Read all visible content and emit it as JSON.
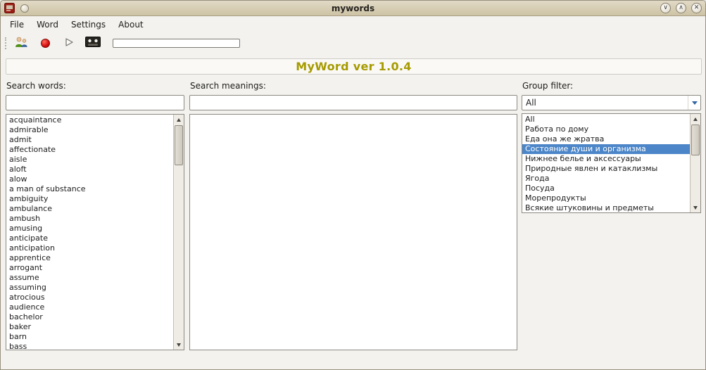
{
  "window": {
    "title": "mywords",
    "controls": [
      {
        "name": "minimize",
        "glyph": "∨"
      },
      {
        "name": "maximize",
        "glyph": "∧"
      },
      {
        "name": "close",
        "glyph": "✕"
      }
    ]
  },
  "menu": {
    "items": [
      "File",
      "Word",
      "Settings",
      "About"
    ]
  },
  "toolbar": {
    "buttons": [
      "users-icon",
      "record-icon",
      "play-icon",
      "cassette-icon"
    ],
    "progress_value": ""
  },
  "banner": {
    "title": "MyWord ver 1.0.4"
  },
  "words_panel": {
    "label": "Search words:",
    "input_value": "",
    "items": [
      "acquaintance",
      "admirable",
      "admit",
      "affectionate",
      "aisle",
      "aloft",
      "alow",
      "a man of substance",
      "ambiguity",
      "ambulance",
      "ambush",
      "amusing",
      "anticipate",
      "anticipation",
      "apprentice",
      "arrogant",
      "assume",
      "assuming",
      "atrocious",
      "audience",
      "bachelor",
      "baker",
      "barn",
      "bass"
    ]
  },
  "meanings_panel": {
    "label": "Search meanings:",
    "input_value": "",
    "items": []
  },
  "filter_panel": {
    "label": "Group filter:",
    "combo_value": "All",
    "highlighted_index": 3,
    "highlighted_item": "Состояние души и организма",
    "items": [
      "All",
      "Работа по дому",
      "Еда она же жратва",
      "Состояние души и организма",
      "Нижнее белье и аксессуары",
      "Природные явлен и катаклизмы",
      "Ягода",
      "Посуда",
      "Морепродукты",
      "Всякие штуковины и предметы"
    ]
  },
  "colors": {
    "titlebar": "#d6ccb4",
    "selection": "#4c86c8",
    "banner_text": "#a69b00",
    "record_red": "#d40d0d"
  }
}
